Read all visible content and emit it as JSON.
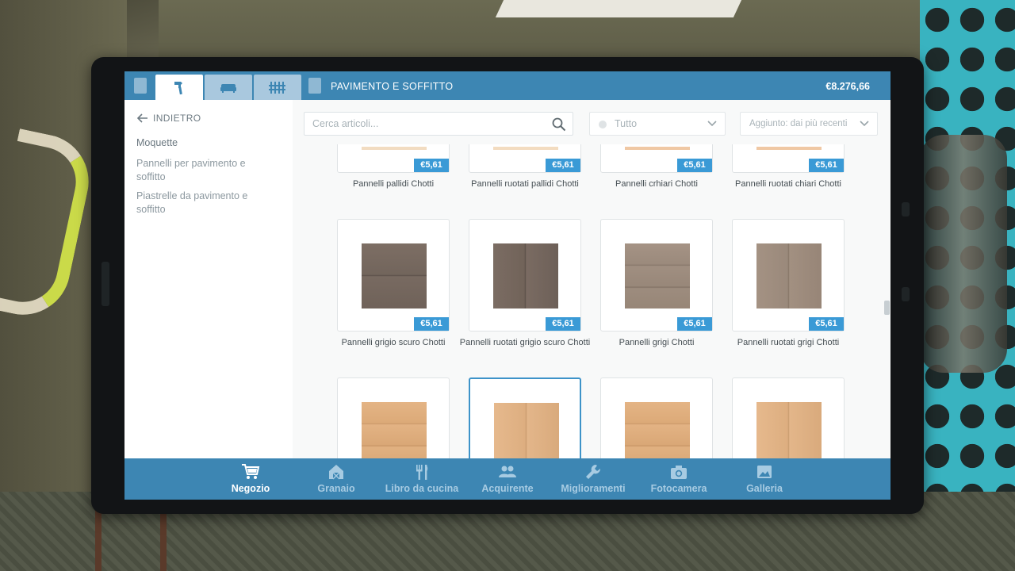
{
  "header": {
    "section_title": "PAVIMENTO E SOFFITTO",
    "balance": "€8.276,66",
    "tabs": [
      {
        "icon": "paint-roller-icon",
        "active": true
      },
      {
        "icon": "sofa-icon",
        "active": false
      },
      {
        "icon": "fence-icon",
        "active": false
      }
    ]
  },
  "sidebar": {
    "back_label": "INDIETRO",
    "categories": [
      {
        "label": "Moquette"
      },
      {
        "label": "Pannelli per pavimento e soffitto"
      },
      {
        "label": "Piastrelle da pavimento e soffitto"
      }
    ]
  },
  "toolbar": {
    "search_placeholder": "Cerca articoli...",
    "filter_value": "Tutto",
    "sort_value": "Aggiunto: dai più recenti"
  },
  "items": [
    {
      "name": "Pannelli pallidi Chotti",
      "price": "€5,61"
    },
    {
      "name": "Pannelli ruotati pallidi Chotti",
      "price": "€5,61"
    },
    {
      "name": "Pannelli crhiari Chotti",
      "price": "€5,61"
    },
    {
      "name": "Pannelli ruotati chiari Chotti",
      "price": "€5,61"
    },
    {
      "name": "Pannelli grigio scuro Chotti",
      "price": "€5,61"
    },
    {
      "name": "Pannelli ruotati grigio scuro Chotti",
      "price": "€5,61"
    },
    {
      "name": "Pannelli grigi Chotti",
      "price": "€5,61"
    },
    {
      "name": "Pannelli ruotati grigi Chotti",
      "price": "€5,61"
    },
    {
      "name": "",
      "price": ""
    },
    {
      "name": "",
      "price": ""
    },
    {
      "name": "",
      "price": ""
    },
    {
      "name": "",
      "price": ""
    }
  ],
  "bottom_nav": [
    {
      "label": "Negozio",
      "icon": "cart-icon",
      "active": true
    },
    {
      "label": "Granaio",
      "icon": "barn-icon",
      "active": false
    },
    {
      "label": "Libro da cucina",
      "icon": "cutlery-icon",
      "active": false
    },
    {
      "label": "Acquirente",
      "icon": "customers-icon",
      "active": false
    },
    {
      "label": "Miglioramenti",
      "icon": "wrench-icon",
      "active": false
    },
    {
      "label": "Fotocamera",
      "icon": "camera-icon",
      "active": false
    },
    {
      "label": "Galleria",
      "icon": "gallery-icon",
      "active": false
    }
  ],
  "colors": {
    "accent": "#3d86b3",
    "price_badge": "#3a9ad6",
    "selected_border": "#3d93c9"
  }
}
